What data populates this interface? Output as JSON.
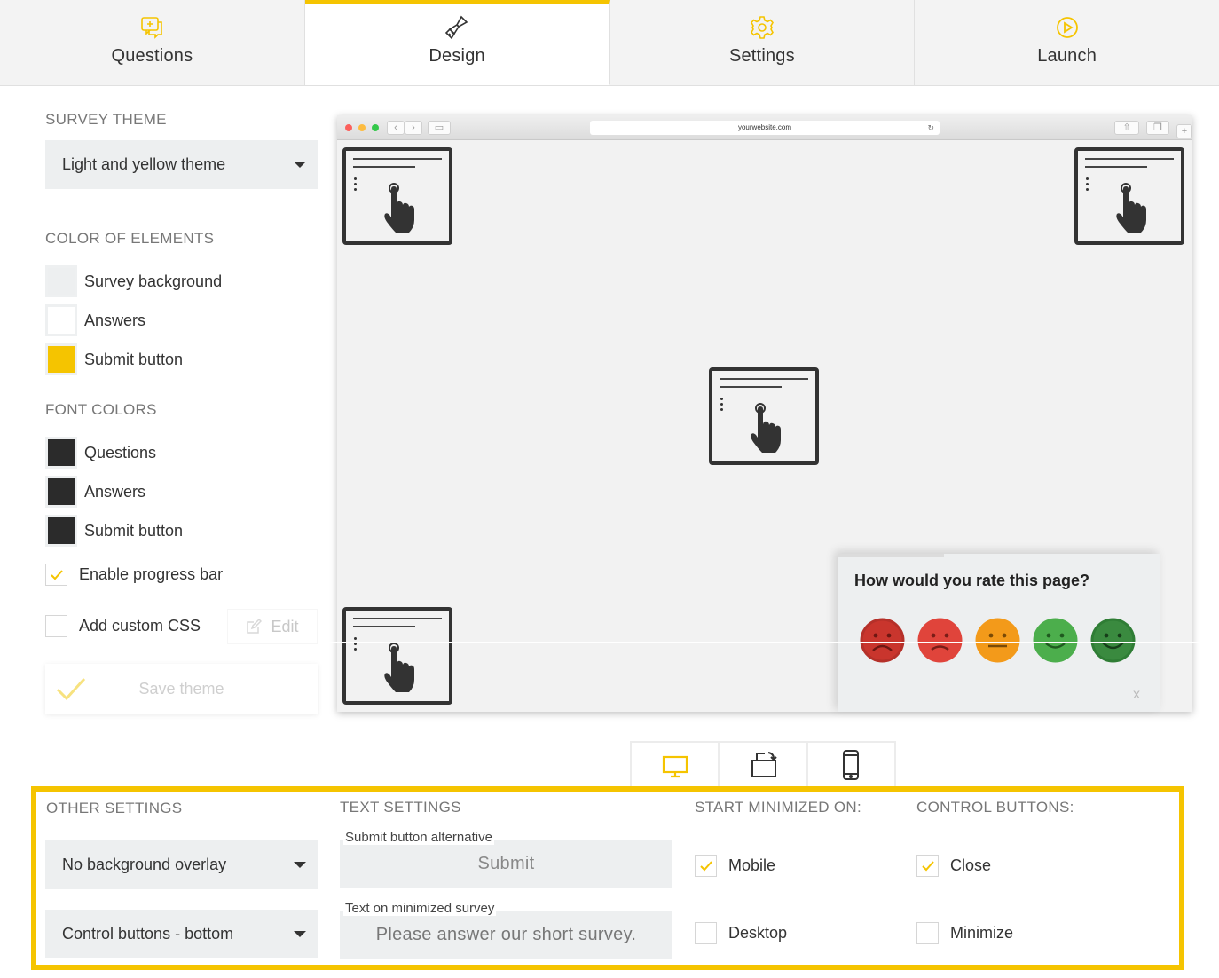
{
  "tabs": [
    {
      "label": "Questions",
      "icon": "chat-plus-icon",
      "active": false
    },
    {
      "label": "Design",
      "icon": "paint-brush-icon",
      "active": true
    },
    {
      "label": "Settings",
      "icon": "gear-icon",
      "active": false
    },
    {
      "label": "Launch",
      "icon": "play-circle-icon",
      "active": false
    }
  ],
  "survey_theme": {
    "title": "SURVEY THEME",
    "selected": "Light and yellow theme"
  },
  "color_of_elements": {
    "title": "COLOR OF ELEMENTS",
    "items": [
      {
        "label": "Survey background",
        "color": "#edeff0"
      },
      {
        "label": "Answers",
        "color": "#ffffff"
      },
      {
        "label": "Submit button",
        "color": "#f5c400"
      }
    ]
  },
  "font_colors": {
    "title": "FONT COLORS",
    "items": [
      {
        "label": "Questions",
        "color": "#2b2b2b"
      },
      {
        "label": "Answers",
        "color": "#2b2b2b"
      },
      {
        "label": "Submit button",
        "color": "#2b2b2b"
      }
    ]
  },
  "progress_bar": {
    "label": "Enable progress bar",
    "checked": true
  },
  "custom_css": {
    "label": "Add custom CSS",
    "checked": false,
    "edit_label": "Edit"
  },
  "save_theme_label": "Save theme",
  "preview": {
    "url": "yourwebsite.com",
    "question": "How would you rate this page?",
    "faces": [
      "very-unhappy-face-icon",
      "unhappy-face-icon",
      "neutral-face-icon",
      "happy-face-icon",
      "very-happy-face-icon"
    ],
    "close_label": "x"
  },
  "devices": [
    "desktop-icon",
    "tablet-rotate-icon",
    "mobile-icon"
  ],
  "other_settings": {
    "title": "OTHER SETTINGS",
    "overlay": "No background overlay",
    "control_position": "Control buttons - bottom"
  },
  "text_settings": {
    "title": "TEXT SETTINGS",
    "submit_label": "Submit button alternative",
    "submit_value": "Submit",
    "minimized_label": "Text on minimized survey",
    "minimized_value": "Please answer our short survey."
  },
  "start_minimized": {
    "title": "START MINIMIZED ON:",
    "mobile": {
      "label": "Mobile",
      "checked": true
    },
    "desktop": {
      "label": "Desktop",
      "checked": false
    }
  },
  "control_buttons": {
    "title": "CONTROL BUTTONS:",
    "close": {
      "label": "Close",
      "checked": true
    },
    "minimize": {
      "label": "Minimize",
      "checked": false
    }
  },
  "colors": {
    "accent": "#f5c400"
  }
}
